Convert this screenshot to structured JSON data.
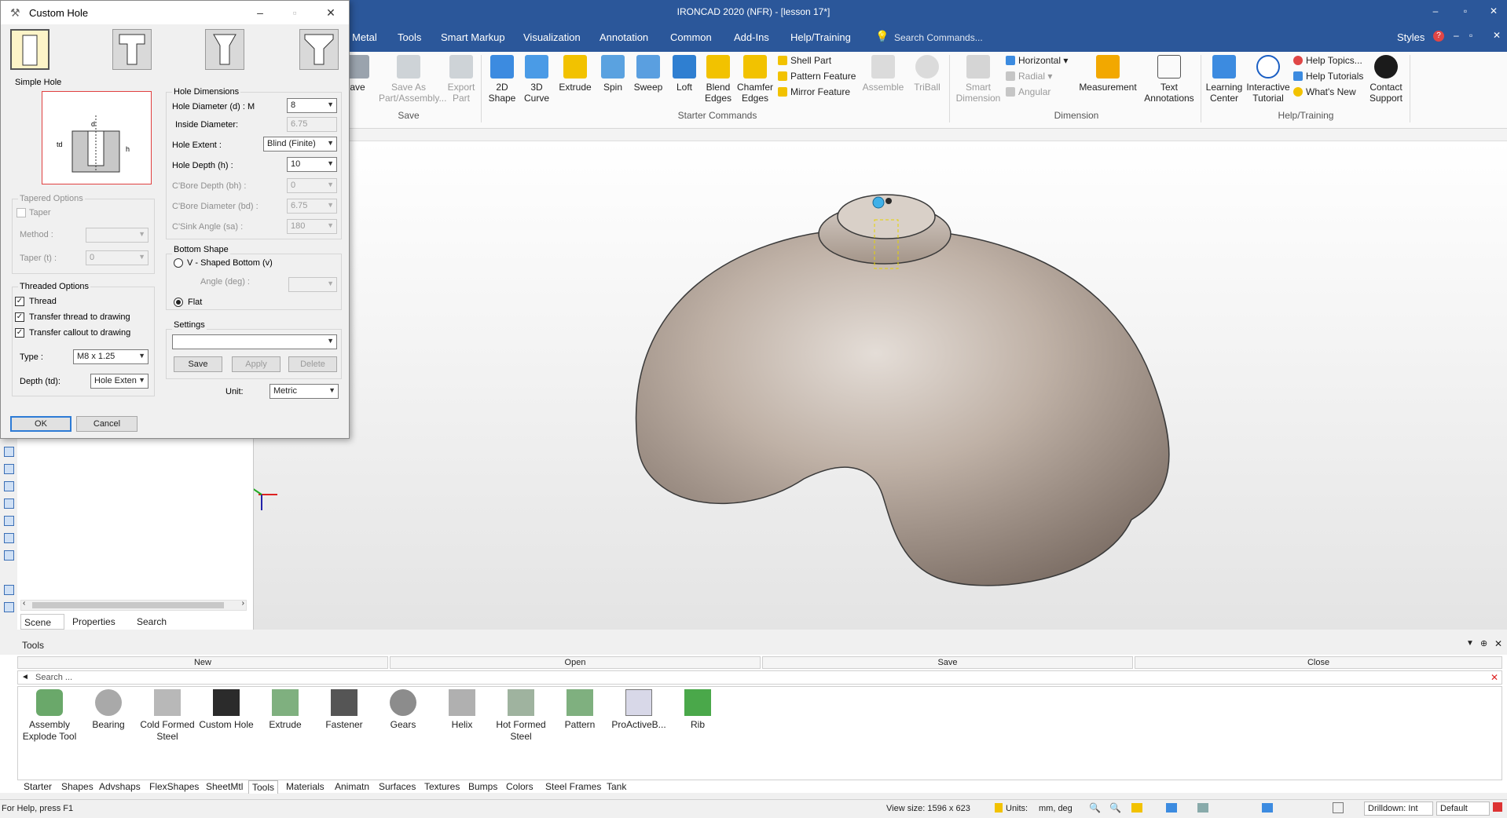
{
  "app": {
    "title": "IRONCAD 2020 (NFR) - [lesson 17*]",
    "window_controls": [
      "–",
      "▫",
      "✕"
    ]
  },
  "menu": {
    "items": [
      "Metal",
      "Tools",
      "Smart Markup",
      "Visualization",
      "Annotation",
      "Common",
      "Add-Ins",
      "Help/Training"
    ],
    "search_placeholder": "Search Commands...",
    "styles_label": "Styles"
  },
  "ribbon": {
    "save_group": {
      "label": "Save",
      "buttons": [
        {
          "label": "ave",
          "enabled": true
        },
        {
          "label": "Save As Part/Assembly...",
          "enabled": false
        },
        {
          "label": "Export Part",
          "enabled": false
        }
      ]
    },
    "starter_group": {
      "label": "Starter Commands",
      "buttons": [
        {
          "label": "2D Shape",
          "enabled": true
        },
        {
          "label": "3D Curve",
          "enabled": true
        },
        {
          "label": "Extrude",
          "enabled": true
        },
        {
          "label": "Spin",
          "enabled": true
        },
        {
          "label": "Sweep",
          "enabled": true
        },
        {
          "label": "Loft",
          "enabled": true
        },
        {
          "label": "Blend Edges",
          "enabled": true
        },
        {
          "label": "Chamfer Edges",
          "enabled": true
        }
      ],
      "small": [
        "Shell Part",
        "Pattern Feature",
        "Mirror Feature"
      ],
      "disabled": [
        "Assemble",
        "TriBall"
      ]
    },
    "dimension_group": {
      "label": "Dimension",
      "smart_dimension": "Smart Dimension",
      "small": [
        {
          "label": "Horizontal",
          "enabled": true
        },
        {
          "label": "Radial",
          "enabled": false
        },
        {
          "label": "Angular",
          "enabled": false
        }
      ],
      "measurement": "Measurement",
      "text_annotations": "Text Annotations"
    },
    "help_group": {
      "label": "Help/Training",
      "buttons": [
        "Learning Center",
        "Interactive Tutorial"
      ],
      "small": [
        "Help Topics...",
        "Help Tutorials",
        "What's New"
      ],
      "contact": "Contact Support"
    }
  },
  "dialog": {
    "title": "Custom Hole",
    "hole_types": [
      "simple-hole",
      "counterbore-hole",
      "countersink-taper-hole",
      "countersink-hole"
    ],
    "section_preview": "Simple Hole",
    "tapered": {
      "heading": "Tapered Options",
      "taper_label": "Taper",
      "method_label": "Method :",
      "method_value": "",
      "taper_t_label": "Taper (t) :",
      "taper_t_value": "0"
    },
    "threaded": {
      "heading": "Threaded Options",
      "thread": "Thread",
      "transfer_thread": "Transfer thread to drawing",
      "transfer_callout": "Transfer callout to drawing",
      "type_label": "Type :",
      "type_value": "M8 x 1.25",
      "depth_label": "Depth (td):",
      "depth_value": "Hole Exten"
    },
    "dimensions": {
      "heading": "Hole Dimensions",
      "diameter_label": "Hole Diameter (d) : M",
      "diameter_value": "8",
      "inside_label": "Inside Diameter:",
      "inside_value": "6.75",
      "extent_label": "Hole Extent :",
      "extent_value": "Blind (Finite)",
      "depth_label": "Hole Depth (h) :",
      "depth_value": "10",
      "cbore_depth_label": "C'Bore Depth (bh) :",
      "cbore_depth_value": "0",
      "cbore_diam_label": "C'Bore Diameter (bd) :",
      "cbore_diam_value": "6.75",
      "csink_label": "C'Sink Angle (sa) :",
      "csink_value": "180"
    },
    "bottom_shape": {
      "heading": "Bottom Shape",
      "v_shaped": "V - Shaped Bottom (v)",
      "angle_label": "Angle (deg) :",
      "angle_value": "",
      "flat": "Flat"
    },
    "settings": {
      "heading": "Settings",
      "value": "",
      "save": "Save",
      "apply": "Apply",
      "delete": "Delete"
    },
    "unit_label": "Unit:",
    "unit_value": "Metric",
    "ok": "OK",
    "cancel": "Cancel"
  },
  "left_panel": {
    "tabs": [
      "Scene",
      "Properties",
      "Search"
    ]
  },
  "tools_catalog": {
    "title": "Tools",
    "actions": [
      "New",
      "Open",
      "Save",
      "Close"
    ],
    "search_placeholder": "Search ...",
    "items": [
      "Assembly Explode Tool",
      "Bearing",
      "Cold Formed Steel",
      "Custom Hole",
      "Extrude",
      "Fastener",
      "Gears",
      "Helix",
      "Hot Formed Steel",
      "Pattern",
      "ProActiveB...",
      "Rib"
    ],
    "tabs": [
      "Starter",
      "Shapes",
      "Advshaps",
      "FlexShapes",
      "SheetMtl",
      "Tools",
      "Materials",
      "Animatn",
      "Surfaces",
      "Textures",
      "Bumps",
      "Colors",
      "Steel Frames",
      "Tank"
    ],
    "active_tab": "Tools"
  },
  "status": {
    "help": "For Help, press F1",
    "view_size": "View size: 1596 x 623",
    "units_label": "Units:",
    "units_value": "mm, deg",
    "drilldown": "Drilldown: Int",
    "default": "Default"
  },
  "colors": {
    "title_blue": "#2b579a",
    "model_tint": "#b5a79b",
    "accent": "#2d7bd6"
  }
}
